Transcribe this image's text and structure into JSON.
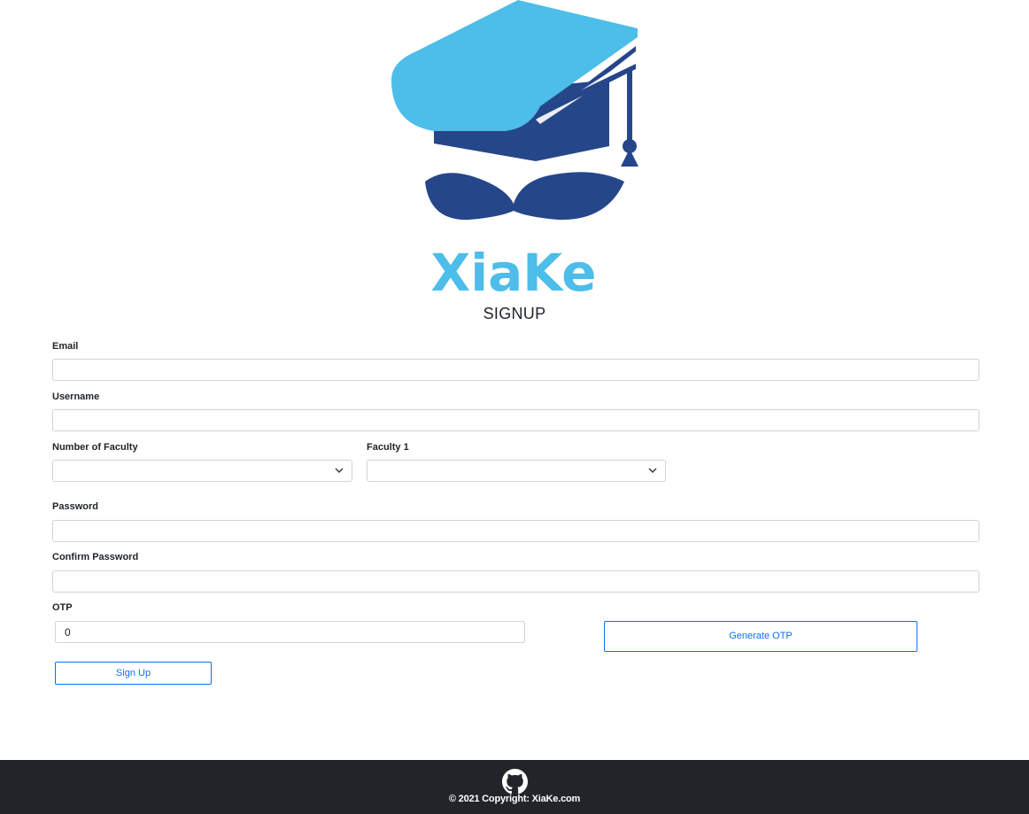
{
  "brand": {
    "name": "XiaKe"
  },
  "page": {
    "title": "SIGNUP"
  },
  "form": {
    "email": {
      "label": "Email",
      "value": ""
    },
    "username": {
      "label": "Username",
      "value": ""
    },
    "number_of_faculty": {
      "label": "Number of Faculty",
      "selected": ""
    },
    "faculty_1": {
      "label": "Faculty 1",
      "selected": ""
    },
    "password": {
      "label": "Password",
      "value": ""
    },
    "confirm_password": {
      "label": "Confirm Password",
      "value": ""
    },
    "otp": {
      "label": "OTP",
      "value": "0"
    },
    "generate_otp_label": "Generate OTP",
    "signup_label": "Sign Up"
  },
  "footer": {
    "icon": "github-icon",
    "copyright": "© 2021 Copyright: XiaKe.com"
  },
  "colors": {
    "accent": "#0d6efd",
    "logo_light_blue": "#4dbde9",
    "logo_dark_blue": "#26468a",
    "footer_bg": "#212529"
  }
}
